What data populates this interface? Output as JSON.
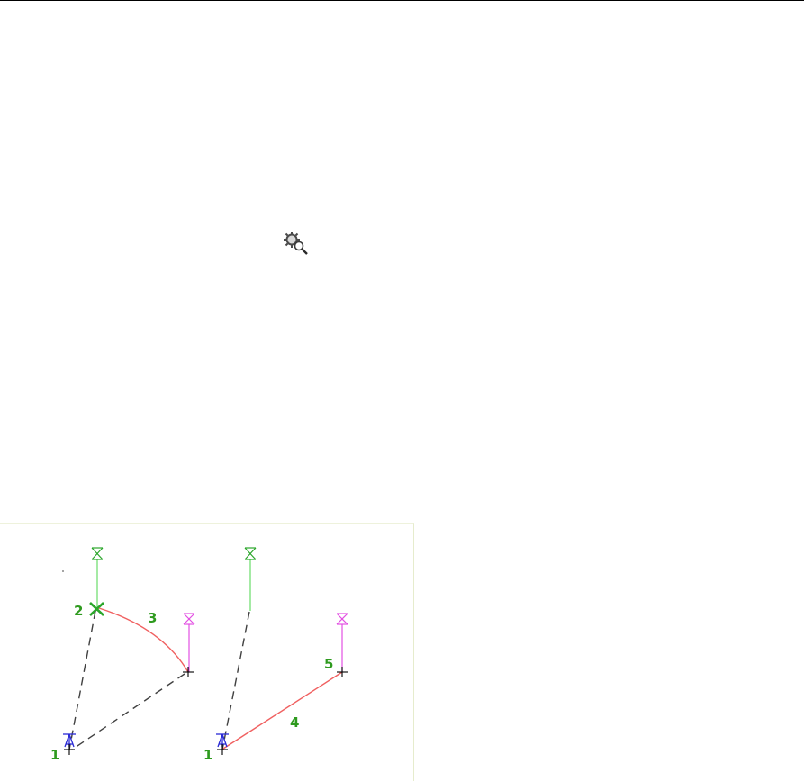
{
  "toolbar": {
    "tool_icon": "zoom-object-icon"
  },
  "drawing": {
    "left_figure": {
      "labels": {
        "start": "1",
        "corner": "2",
        "arc": "3"
      }
    },
    "right_figure": {
      "labels": {
        "start": "1",
        "segment": "4",
        "end": "5"
      }
    },
    "colors": {
      "dashed_line": "#404040",
      "arc_line": "#f06060",
      "green_marker": "#2aa62a",
      "green_stem": "#7ee07e",
      "magenta_marker": "#e24fe2",
      "blue_marker": "#2a2ad6",
      "label_green": "#2e9a1e",
      "cross": "#000000"
    }
  }
}
